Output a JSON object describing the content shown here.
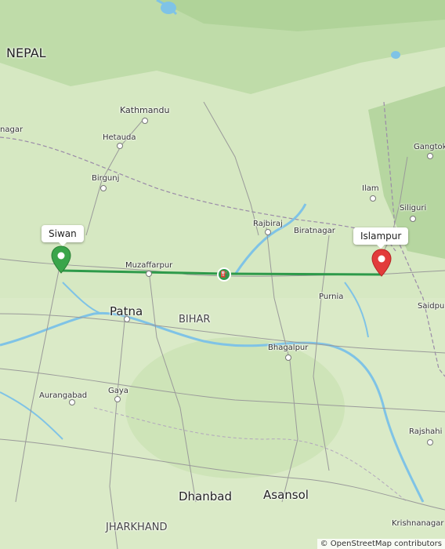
{
  "map": {
    "labels": {
      "country_nepal": "NEPAL",
      "state_bihar": "BIHAR",
      "state_jharkhand": "JHARKHAND",
      "kathmandu": "Kathmandu",
      "hetauda": "Hetauda",
      "birgunj": "Birgunj",
      "muzaffarpur": "Muzaffarpur",
      "patna": "Patna",
      "gaya": "Gaya",
      "aurangabad": "Aurangabad",
      "rajbiraj": "Rajbiraj",
      "biratnagar": "Biratnagar",
      "purnia": "Purnia",
      "bhagalpur": "Bhagalpur",
      "dhanbad": "Dhanbad",
      "asansol": "Asansol",
      "ilam": "Ilam",
      "gangtok": "Gangtok",
      "siliguri": "Siliguri",
      "saidpur": "Saidpur",
      "rajshahi": "Rajshahi",
      "krishnanagar": "Krishnanagar",
      "nagar_partial": "nagar"
    },
    "markers": {
      "origin_label": "Siwan",
      "destination_label": "Islampur"
    },
    "route": {
      "color": "#2e9a4a",
      "midpoint_icon": "route-midpoint-icon"
    },
    "attribution": "© OpenStreetMap contributors"
  },
  "colors": {
    "land": "#cfe3b8",
    "water": "#7fc3e6",
    "road": "#9a9a9a",
    "origin_pin": "#3aa54a",
    "destination_pin": "#e23b3b"
  }
}
